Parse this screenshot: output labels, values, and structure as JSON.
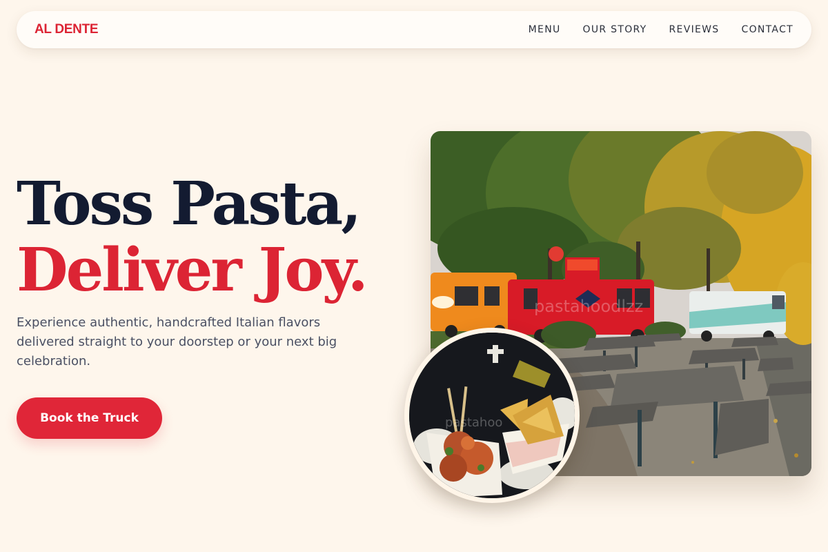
{
  "brand": {
    "name": "AL DENTE",
    "color": "#dc2434"
  },
  "nav": {
    "items": [
      {
        "label": "MENU"
      },
      {
        "label": "OUR STORY"
      },
      {
        "label": "REVIEWS"
      },
      {
        "label": "CONTACT"
      }
    ]
  },
  "hero": {
    "headline_line1": "Toss Pasta,",
    "headline_line2": "Deliver Joy.",
    "subtitle": "Experience authentic, handcrafted Italian flavors delivered straight to your doorstep or your next big celebration.",
    "cta_label": "Book the Truck"
  },
  "images": {
    "main_photo": "food-trucks-park-photo",
    "circle_photo": "meatballs-samosas-food-photo"
  },
  "colors": {
    "background": "#fef6ec",
    "accent": "#dc2434",
    "headline_dark": "#131b31",
    "body_text": "#4a5063"
  }
}
